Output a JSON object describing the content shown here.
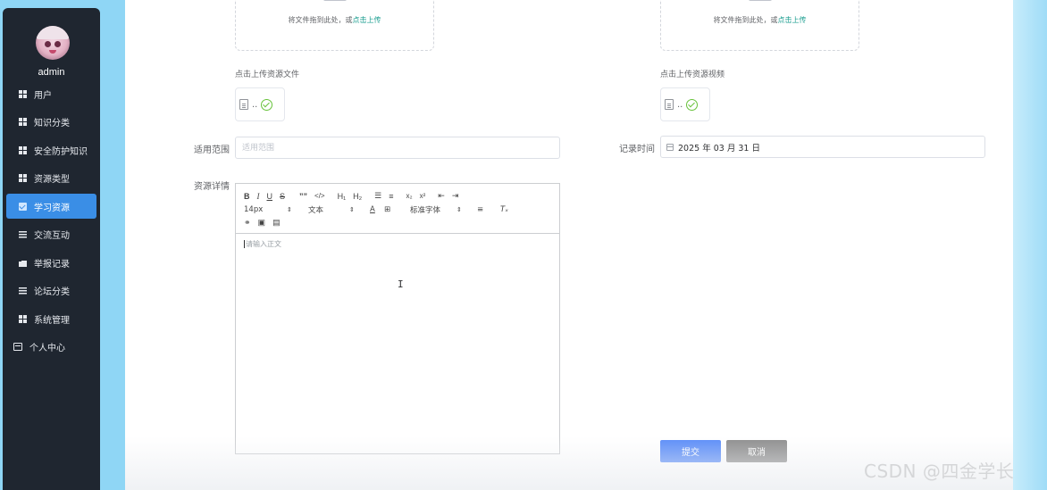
{
  "sidebar": {
    "username": "admin",
    "items": [
      {
        "label": "用户",
        "icon": "grid-icon"
      },
      {
        "label": "知识分类",
        "icon": "grid-icon"
      },
      {
        "label": "安全防护知识",
        "icon": "grid-icon"
      },
      {
        "label": "资源类型",
        "icon": "grid-icon"
      },
      {
        "label": "学习资源",
        "icon": "check-square-icon",
        "active": true
      },
      {
        "label": "交流互动",
        "icon": "menu-lines-icon"
      },
      {
        "label": "举报记录",
        "icon": "thumb-icon"
      },
      {
        "label": "论坛分类",
        "icon": "menu-lines-icon"
      },
      {
        "label": "系统管理",
        "icon": "grid-icon"
      },
      {
        "label": "个人中心",
        "icon": "card-icon"
      }
    ]
  },
  "form": {
    "file_upload": {
      "drop_text": "将文件拖到此处，或",
      "drop_link": "点击上传",
      "label": "点击上传资源文件",
      "file_name": ".."
    },
    "video_upload": {
      "drop_text": "将文件拖到此处，或",
      "drop_link": "点击上传",
      "label": "点击上传资源视频",
      "file_name": ".."
    },
    "scope": {
      "label": "适用范围",
      "placeholder": "适用范围"
    },
    "record_time": {
      "label": "记录时间",
      "value": "2025 年 03 月 31 日"
    },
    "details": {
      "label": "资源详情",
      "placeholder": "请输入正文",
      "toolbar": {
        "row1": [
          "B",
          "I",
          "U",
          "S",
          "””",
          "</>",
          "H₁",
          "H₂",
          "☰",
          "≡",
          "x₂",
          "x²",
          "⇤",
          "⇥"
        ],
        "font_size": "14px",
        "text_style": "文本",
        "font_family": "标准字体",
        "row2_icons": [
          "A",
          "⊞",
          "≡",
          "Tₓ"
        ],
        "row3_icons": [
          "⚭",
          "▣",
          "▤"
        ]
      }
    },
    "submit_label": "提交",
    "cancel_label": "取消"
  },
  "watermark": "CSDN @四金学长"
}
